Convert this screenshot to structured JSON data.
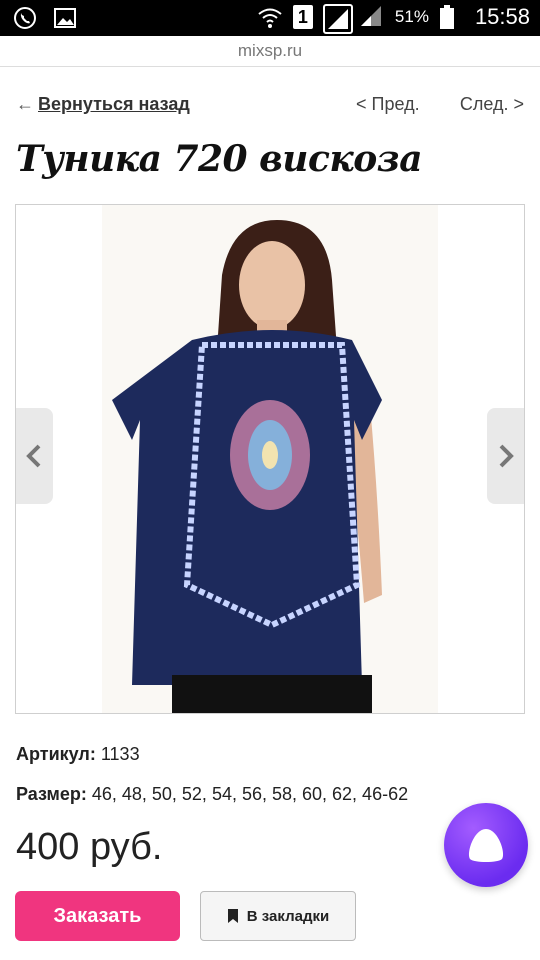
{
  "status_bar": {
    "signal_box_label": "1",
    "battery_percent": "51%",
    "time": "15:58"
  },
  "url_bar": {
    "domain": "mixsp.ru"
  },
  "nav": {
    "back_arrow": "←",
    "back_label": "Вернуться назад",
    "prev_label": "< Пред.",
    "next_label": "След. >"
  },
  "product": {
    "title": "Туника 720 вискоза",
    "article_label": "Артикул:",
    "article_value": "1133",
    "size_label": "Размер:",
    "size_value": "46, 48, 50, 52, 54, 56, 58, 60, 62, 46-62",
    "price": "400 руб."
  },
  "buttons": {
    "order_label": "Заказать",
    "bookmark_label": "В закладки"
  },
  "colors": {
    "accent": "#f0357f",
    "assistant": "#7a3cf5",
    "tunic": "#1d2a5c"
  }
}
